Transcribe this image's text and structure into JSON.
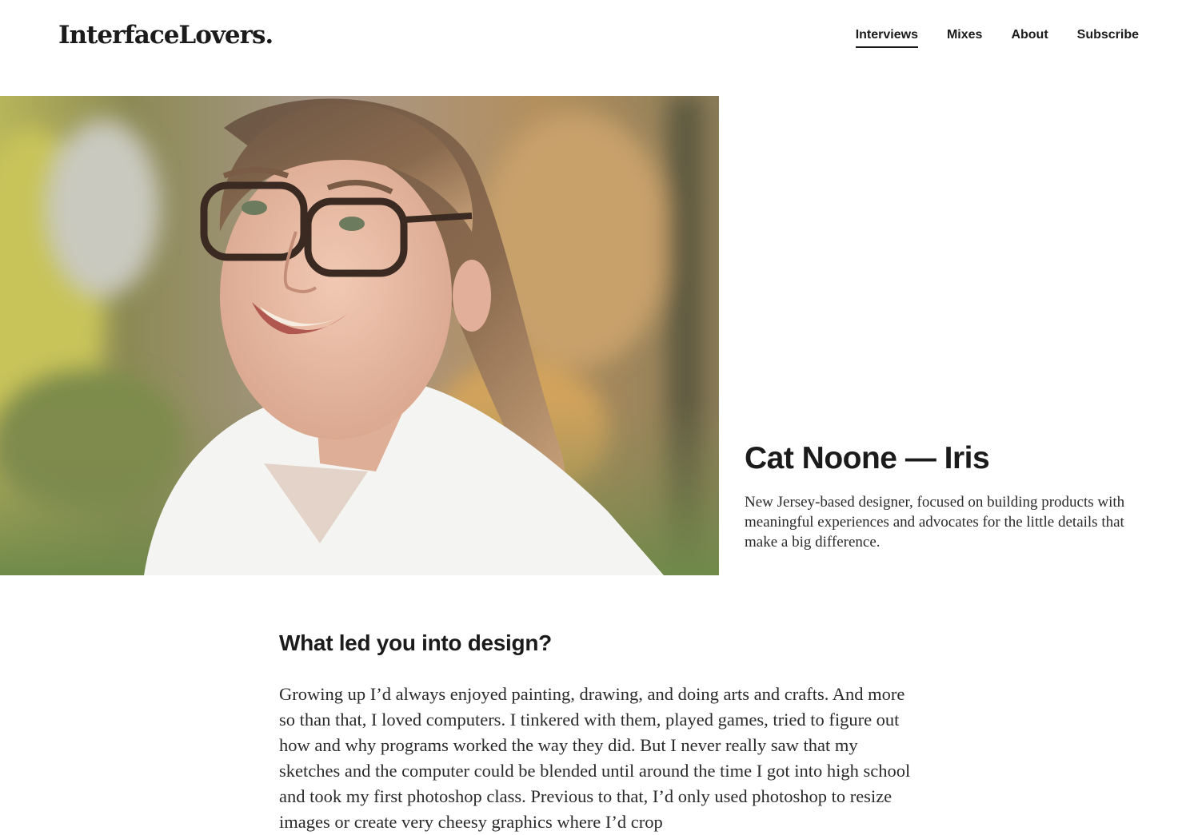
{
  "header": {
    "logo": "InterfaceLovers.",
    "nav": [
      {
        "label": "Interviews",
        "active": true
      },
      {
        "label": "Mixes",
        "active": false
      },
      {
        "label": "About",
        "active": false
      },
      {
        "label": "Subscribe",
        "active": false
      }
    ]
  },
  "hero": {
    "photo_subject": "portrait-photo",
    "title": "Cat Noone — Iris",
    "description": "New Jersey-based designer, focused on building products with meaningful experiences and advocates for the little details that make a big difference."
  },
  "article": {
    "question": "What led you into design?",
    "answer": "Growing up I’d always enjoyed painting, drawing, and doing arts and crafts. And more so than that, I loved computers. I tinkered with them, played games, tried to figure out how and why programs worked the way they did. But I never really saw that my sketches and the computer could be blended until around the time I got into high school and took my first photoshop class. Previous to that, I’d only used photoshop to resize images or create very cheesy graphics where I’d crop"
  },
  "colors": {
    "text": "#1b1b1b",
    "background": "#ffffff"
  }
}
